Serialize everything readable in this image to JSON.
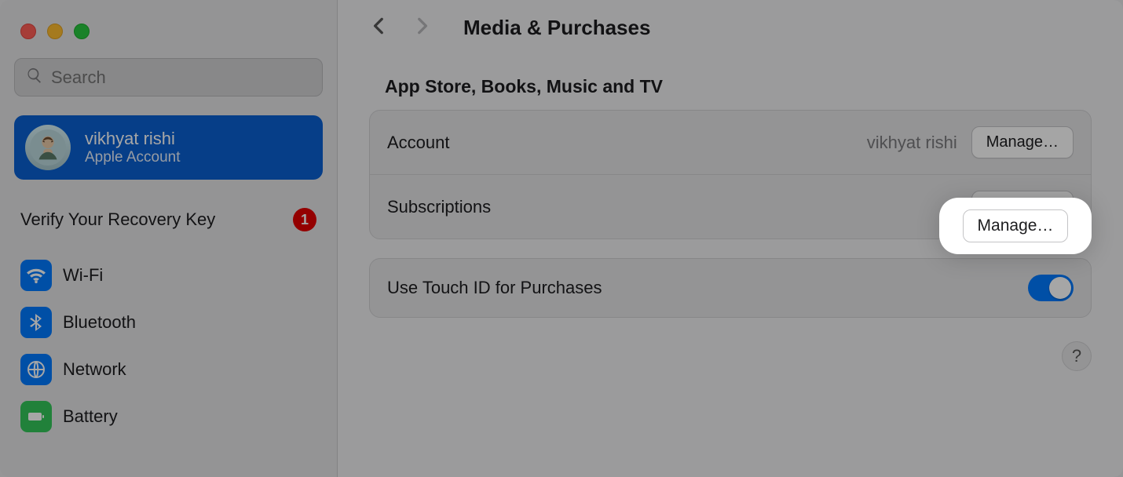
{
  "search": {
    "placeholder": "Search"
  },
  "account": {
    "name": "vikhyat rishi",
    "subtitle": "Apple Account"
  },
  "recovery": {
    "label": "Verify Your Recovery Key",
    "badge": "1"
  },
  "sidebar": {
    "items": [
      {
        "label": "Wi-Fi"
      },
      {
        "label": "Bluetooth"
      },
      {
        "label": "Network"
      },
      {
        "label": "Battery"
      }
    ]
  },
  "header": {
    "title": "Media & Purchases"
  },
  "section": {
    "title": "App Store, Books, Music and TV"
  },
  "rows": {
    "account": {
      "label": "Account",
      "value": "vikhyat rishi",
      "button": "Manage…"
    },
    "subscriptions": {
      "label": "Subscriptions",
      "button": "Manage…"
    },
    "touchid": {
      "label": "Use Touch ID for Purchases",
      "toggle_on": true
    }
  },
  "help": {
    "glyph": "?"
  },
  "highlight": {
    "button": "Manage…"
  }
}
